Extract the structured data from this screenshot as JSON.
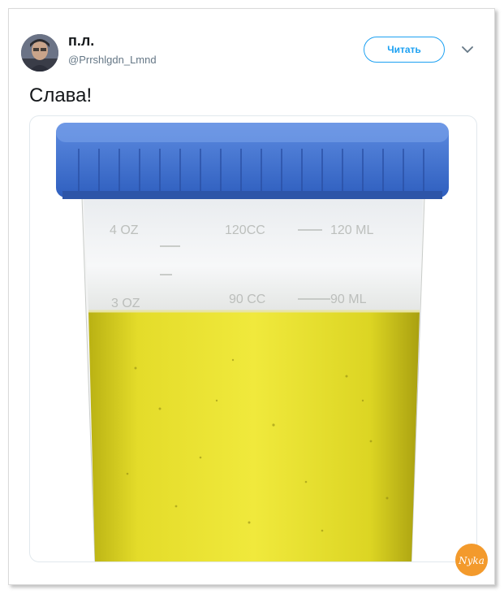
{
  "tweet": {
    "author_name": "п.л.",
    "author_handle": "@Prrshlgdn_Lmnd",
    "follow_label": "Читать",
    "text": "Слава!"
  },
  "media": {
    "labels": {
      "lid_upper_left": "4 OZ",
      "lid_upper_mid": "120CC",
      "lid_upper_right": "120 ML",
      "lower_left": "3 OZ",
      "lower_mid": "90 CC",
      "lower_right": "90 ML"
    }
  },
  "watermark": {
    "text": "Nyka"
  },
  "colors": {
    "accent": "#1da1f2",
    "cap_blue": "#3b6fd0",
    "liquid_yellow": "#d9d21c",
    "watermark_orange": "#f39a2c"
  },
  "icons": {
    "menu": "chevron-down-icon"
  }
}
